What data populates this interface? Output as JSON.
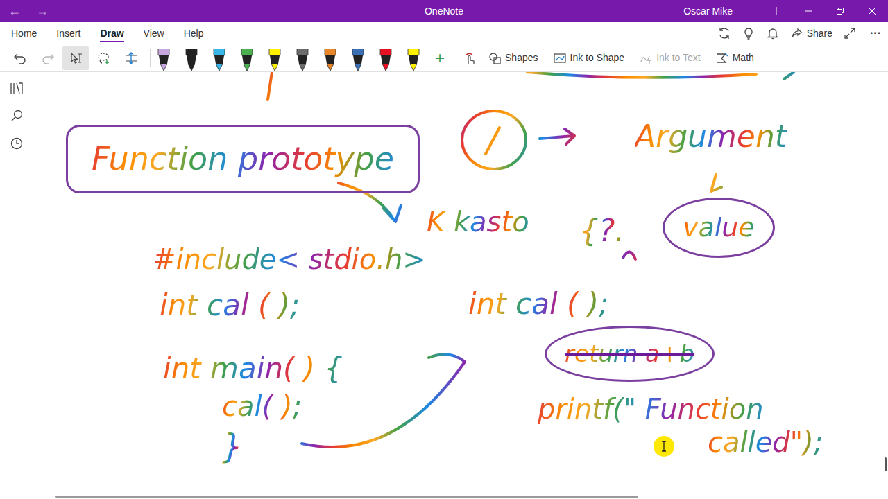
{
  "window": {
    "title": "OneNote",
    "user": "Oscar Mike"
  },
  "nav": {
    "back": "←",
    "forward": "→"
  },
  "tabs": [
    {
      "label": "Home",
      "selected": false
    },
    {
      "label": "Insert",
      "selected": false
    },
    {
      "label": "Draw",
      "selected": true
    },
    {
      "label": "View",
      "selected": false
    },
    {
      "label": "Help",
      "selected": false
    }
  ],
  "header": {
    "share": "Share",
    "more": "···"
  },
  "toolbar": {
    "tools": [
      {
        "selected": false,
        "disabled": false
      },
      {
        "selected": false,
        "disabled": true
      },
      {
        "selected": true,
        "disabled": false
      },
      {
        "selected": false,
        "disabled": false
      },
      {
        "selected": false,
        "disabled": false
      }
    ],
    "pens": [
      {
        "color": "#c7a6e0",
        "selected": false
      },
      {
        "color": "#222222",
        "selected": false
      },
      {
        "color": "#38b6e8",
        "selected": false
      },
      {
        "color": "#4caf50",
        "selected": false
      },
      {
        "color": "#fff200",
        "selected": false
      },
      {
        "color": "#6b6b6b",
        "selected": false
      },
      {
        "color": "#e8862a",
        "selected": false
      },
      {
        "color": "#3b6fb6",
        "selected": false
      },
      {
        "color": "#e81123",
        "selected": false
      },
      {
        "color": "#fff100",
        "selected": false
      }
    ],
    "add_pen": "+",
    "buttons": [
      {
        "label": "Shapes",
        "disabled": false
      },
      {
        "label": "Ink to Shape",
        "disabled": false
      },
      {
        "label": "Ink to Text",
        "disabled": true
      },
      {
        "label": "Math",
        "disabled": false
      }
    ]
  },
  "ink": [
    {
      "text": "Function prototype",
      "kind": "boxed",
      "crossed": false
    },
    {
      "text": "Argument",
      "kind": "plain",
      "crossed": false
    },
    {
      "text": "value",
      "kind": "circled",
      "crossed": false
    },
    {
      "text": "K kasto",
      "kind": "plain",
      "crossed": false
    },
    {
      "text": "{?.",
      "kind": "plain",
      "crossed": false
    },
    {
      "text": "#include< stdio.h>",
      "kind": "plain",
      "crossed": false
    },
    {
      "text": "int cal ( );",
      "kind": "plain",
      "crossed": false
    },
    {
      "text": "int cal ( );",
      "kind": "plain",
      "crossed": false
    },
    {
      "text": "int main( ) {",
      "kind": "plain",
      "crossed": false
    },
    {
      "text": "cal( );",
      "kind": "plain",
      "crossed": false
    },
    {
      "text": "}",
      "kind": "plain",
      "crossed": false
    },
    {
      "text": "return a+b",
      "kind": "circled",
      "crossed": true
    },
    {
      "text": "printf(\" Function",
      "kind": "plain",
      "crossed": false
    },
    {
      "text": "called\");",
      "kind": "plain",
      "crossed": false
    }
  ]
}
